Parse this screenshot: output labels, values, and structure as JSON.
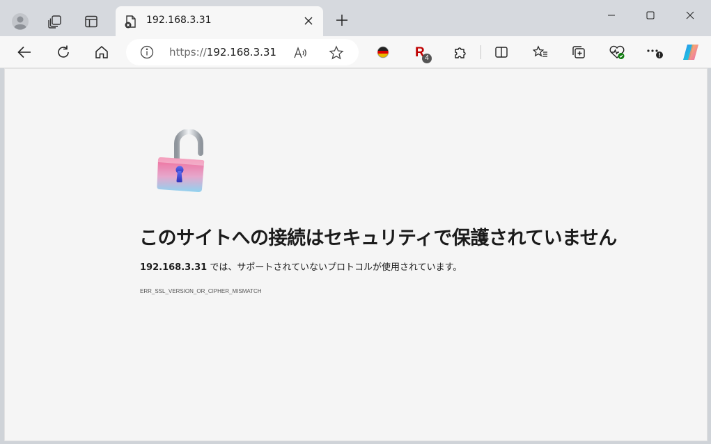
{
  "tab": {
    "title": "192.168.3.31"
  },
  "address": {
    "scheme": "https://",
    "host": "192.168.3.31"
  },
  "extensions": {
    "rakuten_badge": "4"
  },
  "error": {
    "heading": "このサイトへの接続はセキュリティで保護されていません",
    "host": "192.168.3.31",
    "message": " では、サポートされていないプロトコルが使用されています。",
    "code": "ERR_SSL_VERSION_OR_CIPHER_MISMATCH"
  },
  "icons": {
    "profile": "profile-icon",
    "workspaces": "workspaces-icon",
    "vertical_tabs": "vertical-tabs-icon",
    "tab_fav": "broken-page-icon",
    "tab_close": "close-icon",
    "new_tab": "plus-icon",
    "back": "arrow-left-icon",
    "refresh": "refresh-icon",
    "home": "home-icon",
    "info": "info-icon",
    "read_aloud": "read-aloud-icon",
    "favorite": "star-icon",
    "lock": "unlocked-padlock-icon"
  },
  "colors": {
    "tabbar": "#d6d9de",
    "toolbar": "#f7f7f7",
    "page": "#f5f5f5",
    "text": "#1b1b1b"
  }
}
